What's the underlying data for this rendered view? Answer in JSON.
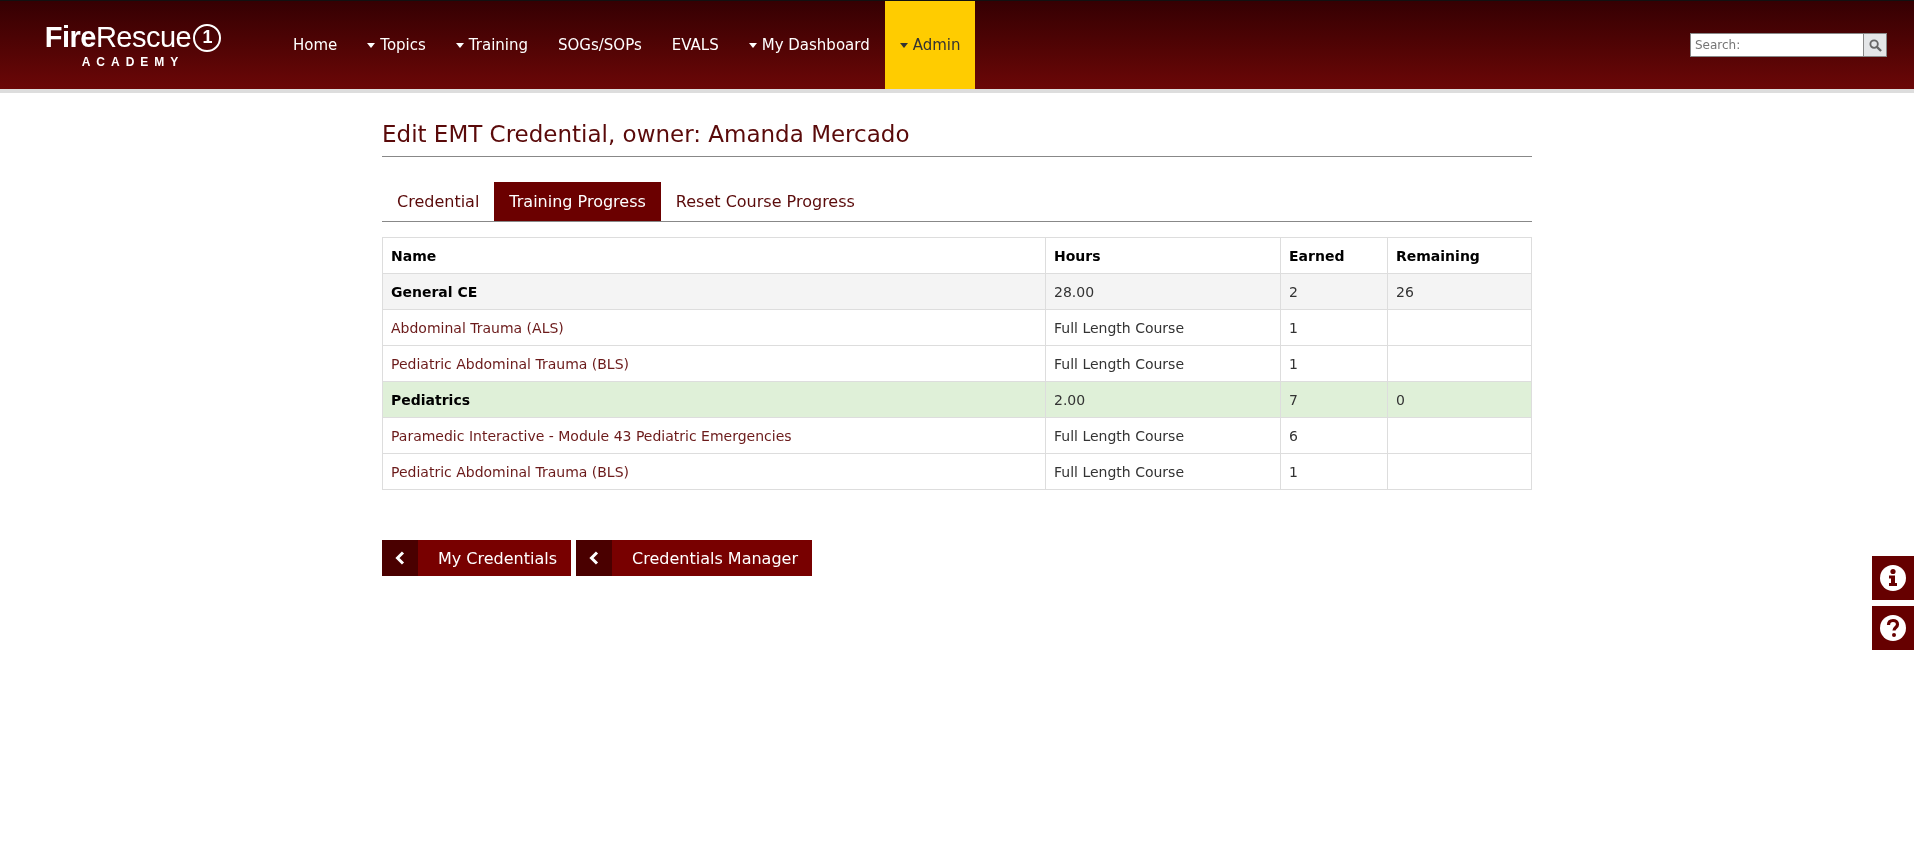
{
  "logo": {
    "bold": "Fire",
    "rest": "Rescue",
    "mark": "1",
    "sub": "ACADEMY"
  },
  "nav": [
    {
      "label": "Home",
      "dropdown": false,
      "selected": false
    },
    {
      "label": "Topics",
      "dropdown": true,
      "selected": false
    },
    {
      "label": "Training",
      "dropdown": true,
      "selected": false
    },
    {
      "label": "SOGs/SOPs",
      "dropdown": false,
      "selected": false
    },
    {
      "label": "EVALS",
      "dropdown": false,
      "selected": false
    },
    {
      "label": "My Dashboard",
      "dropdown": true,
      "selected": false
    },
    {
      "label": "Admin",
      "dropdown": true,
      "selected": true
    }
  ],
  "search": {
    "placeholder": "Search:"
  },
  "page_title": "Edit EMT Credential, owner: Amanda Mercado",
  "tabs": [
    {
      "label": "Credential",
      "selected": false
    },
    {
      "label": "Training Progress",
      "selected": true
    },
    {
      "label": "Reset Course Progress",
      "selected": false
    }
  ],
  "table": {
    "columns": [
      "Name",
      "Hours",
      "Earned",
      "Remaining"
    ],
    "rows": [
      {
        "kind": "group",
        "complete": false,
        "cells": [
          "General CE",
          "28.00",
          "2",
          "26"
        ]
      },
      {
        "kind": "course",
        "cells": [
          "Abdominal Trauma (ALS)",
          "Full Length Course",
          "1",
          ""
        ]
      },
      {
        "kind": "course",
        "cells": [
          "Pediatric Abdominal Trauma (BLS)",
          "Full Length Course",
          "1",
          ""
        ]
      },
      {
        "kind": "group",
        "complete": true,
        "cells": [
          "Pediatrics",
          "2.00",
          "7",
          "0"
        ]
      },
      {
        "kind": "course",
        "cells": [
          "Paramedic Interactive - Module 43 Pediatric Emergencies",
          "Full Length Course",
          "6",
          ""
        ]
      },
      {
        "kind": "course",
        "cells": [
          "Pediatric Abdominal Trauma (BLS)",
          "Full Length Course",
          "1",
          ""
        ]
      }
    ]
  },
  "buttons": [
    "My Credentials",
    "Credentials Manager"
  ]
}
